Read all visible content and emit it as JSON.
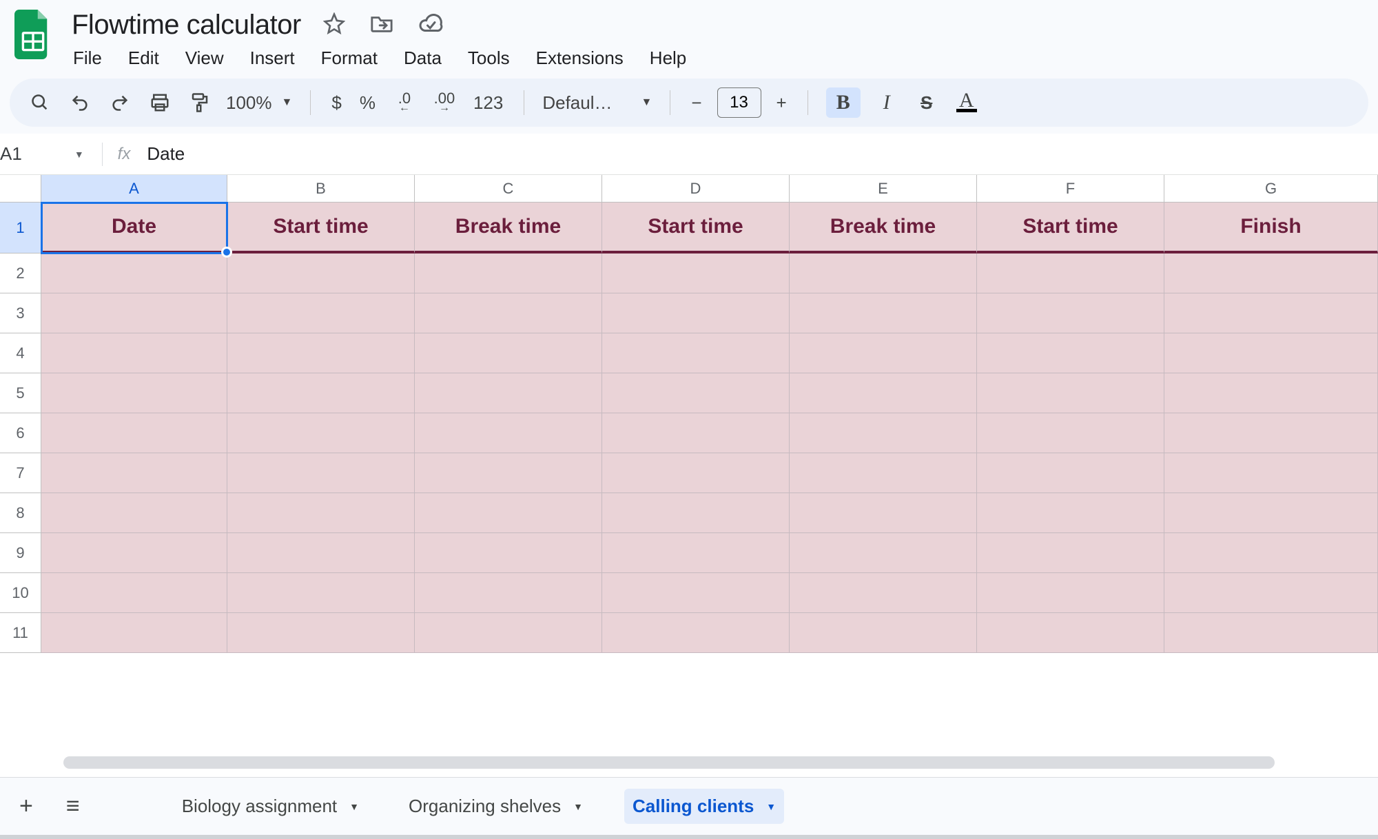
{
  "doc": {
    "title": "Flowtime calculator"
  },
  "menu": {
    "items": [
      "File",
      "Edit",
      "View",
      "Insert",
      "Format",
      "Data",
      "Tools",
      "Extensions",
      "Help"
    ]
  },
  "toolbar": {
    "zoom": "100%",
    "currency": "$",
    "percent": "%",
    "dec_dec": ".0",
    "inc_dec": ".00",
    "num_fmt": "123",
    "font": "Defaul…",
    "minus": "−",
    "font_size": "13",
    "plus": "+",
    "bold": "B",
    "italic": "I",
    "strike": "S"
  },
  "namebox": {
    "ref": "A1"
  },
  "formula": {
    "fx": "fx",
    "value": "Date"
  },
  "columns": [
    "A",
    "B",
    "C",
    "D",
    "E",
    "F",
    "G"
  ],
  "rows": [
    "1",
    "2",
    "3",
    "4",
    "5",
    "6",
    "7",
    "8",
    "9",
    "10",
    "11"
  ],
  "headers_row1": [
    "Date",
    "Start time",
    "Break time",
    "Start time",
    "Break time",
    "Start time",
    "Finish"
  ],
  "tabs": {
    "items": [
      "Biology assignment",
      "Organizing shelves",
      "Calling clients"
    ],
    "active_index": 2
  }
}
